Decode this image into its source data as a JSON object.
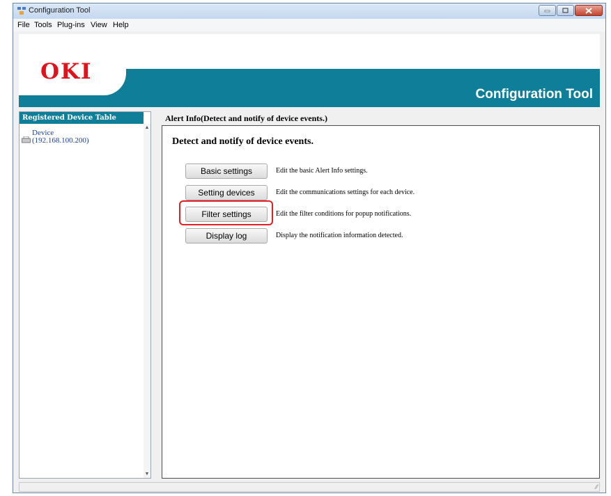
{
  "window": {
    "title": "Configuration Tool"
  },
  "menu": [
    "File",
    "Tools",
    "Plug-ins",
    "View",
    "Help"
  ],
  "banner": {
    "logo": "OKI",
    "title": "Configuration Tool"
  },
  "sidebar": {
    "header": "Registered Device Table",
    "device": {
      "name": "Device",
      "ip": "(192.168.100.200)"
    }
  },
  "content": {
    "title": "Alert Info(Detect and notify of device events.)",
    "heading": "Detect and notify of device events.",
    "actions": [
      {
        "label": "Basic settings",
        "description": "Edit the basic Alert Info settings."
      },
      {
        "label": "Setting devices",
        "description": "Edit the communications settings for each device."
      },
      {
        "label": "Filter settings",
        "description": "Edit the filter conditions for popup notifications."
      },
      {
        "label": "Display log",
        "description": "Display the notification information detected."
      }
    ]
  },
  "colors": {
    "brand_teal": "#0f7e99",
    "logo_red": "#e0131d",
    "highlight_red": "#e31e24"
  }
}
